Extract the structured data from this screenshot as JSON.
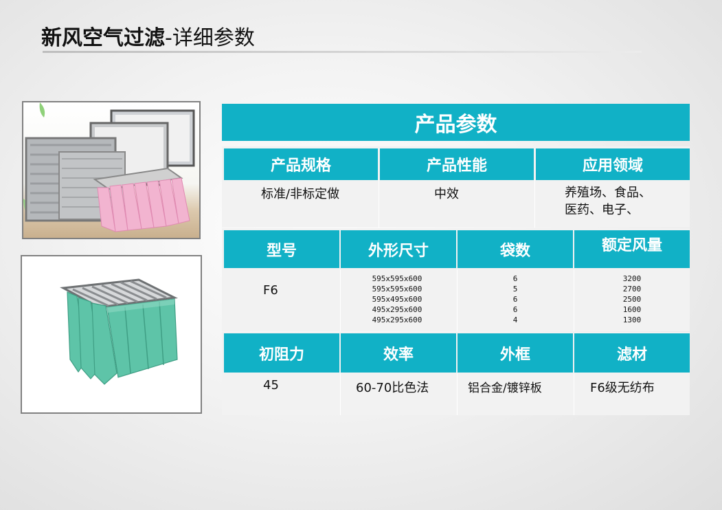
{
  "title": {
    "bold": "新风空气过滤",
    "normal": "-详细参数"
  },
  "images": {
    "photo1": "filter-assortment-photo",
    "photo2": "green-bag-filter-photo"
  },
  "colors": {
    "header": "#11b1c6",
    "cell": "#f2f2f2"
  },
  "main_header": "产品参数",
  "section1": {
    "headers": [
      "产品规格",
      "产品性能",
      "应用领域"
    ],
    "values": [
      "标准/非标定做",
      "中效",
      "养殖场、食品、\n医药、电子、"
    ]
  },
  "section2": {
    "headers": [
      "型号",
      "外形尺寸",
      "袋数",
      "额定风量"
    ],
    "model": "F6",
    "sizes": [
      "595x595x600",
      "595x595x600",
      "595x495x600",
      "495x295x600",
      "495x295x600"
    ],
    "bags": [
      "6",
      "5",
      "6",
      "6",
      "4"
    ],
    "airflow": [
      "3200",
      "2700",
      "2500",
      "1600",
      "1300"
    ]
  },
  "section3": {
    "headers": [
      "初阻力",
      "效率",
      "外框",
      "滤材"
    ],
    "values": [
      "45",
      "60-70比色法",
      "铝合金/镀锌板",
      "F6级无纺布"
    ]
  }
}
